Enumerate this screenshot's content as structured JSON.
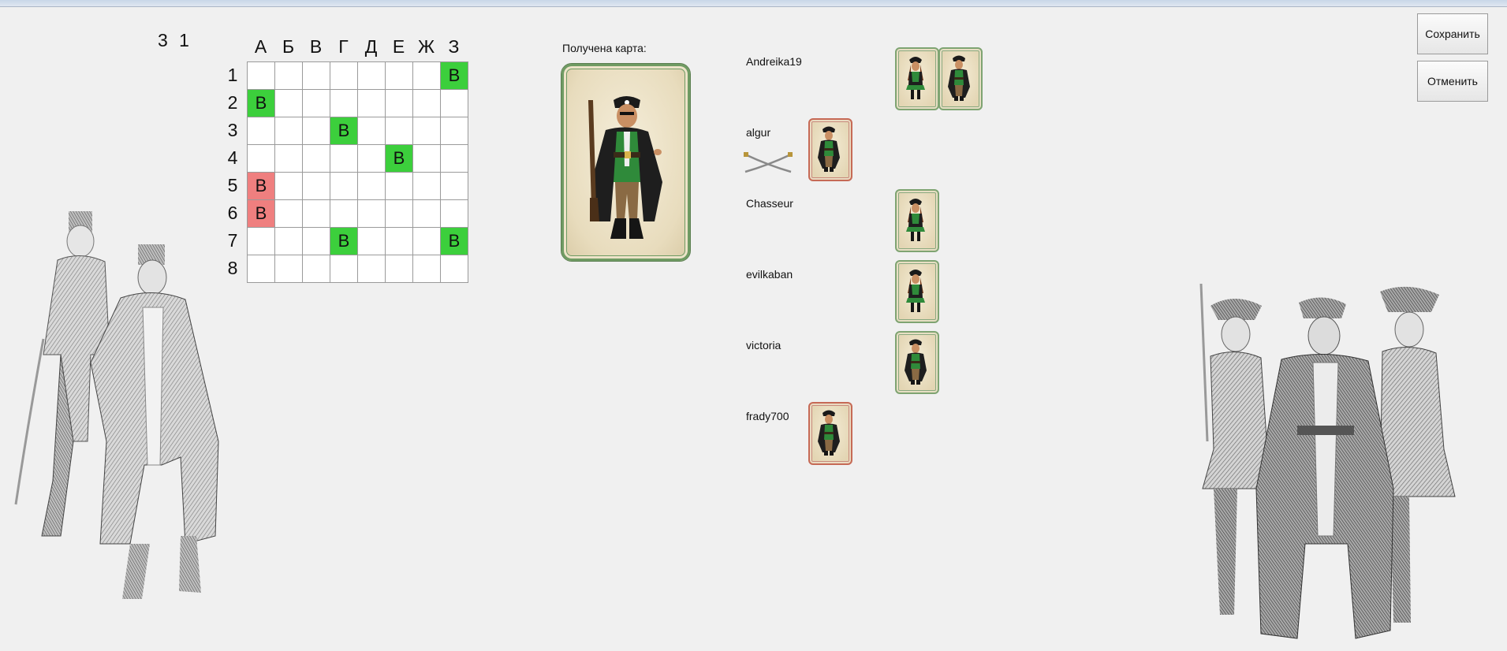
{
  "score": "3 1",
  "board": {
    "columns": [
      "А",
      "Б",
      "В",
      "Г",
      "Д",
      "Е",
      "Ж",
      "З"
    ],
    "rows": [
      "1",
      "2",
      "3",
      "4",
      "5",
      "6",
      "7",
      "8"
    ],
    "marked_cells": [
      {
        "row": "1",
        "col": "З",
        "text": "В",
        "color": "green"
      },
      {
        "row": "2",
        "col": "А",
        "text": "В",
        "color": "green"
      },
      {
        "row": "3",
        "col": "Г",
        "text": "В",
        "color": "green"
      },
      {
        "row": "4",
        "col": "Е",
        "text": "В",
        "color": "green"
      },
      {
        "row": "5",
        "col": "А",
        "text": "В",
        "color": "red"
      },
      {
        "row": "6",
        "col": "А",
        "text": "В",
        "color": "red"
      },
      {
        "row": "7",
        "col": "Г",
        "text": "В",
        "color": "green"
      },
      {
        "row": "7",
        "col": "З",
        "text": "В",
        "color": "green"
      }
    ]
  },
  "received_card": {
    "label": "Получена карта:",
    "character": "pirate-man"
  },
  "players": [
    {
      "name": "Andreika19",
      "cards": [
        {
          "character": "pirate-woman",
          "border": "green"
        },
        {
          "character": "pirate-man",
          "border": "green"
        }
      ]
    },
    {
      "name": "algur",
      "icon": "crossed-swords-icon",
      "cards": [
        {
          "character": "pirate-man",
          "border": "red"
        }
      ]
    },
    {
      "name": "Chasseur",
      "cards": [
        {
          "character": "pirate-woman",
          "border": "green"
        }
      ]
    },
    {
      "name": "evilkaban",
      "cards": [
        {
          "character": "pirate-woman",
          "border": "green"
        }
      ]
    },
    {
      "name": "victoria",
      "cards": [
        {
          "character": "pirate-man",
          "border": "green"
        }
      ]
    },
    {
      "name": "frady700",
      "cards": [
        {
          "character": "pirate-man",
          "border": "red"
        }
      ]
    }
  ],
  "buttons": {
    "save": "Сохранить",
    "cancel": "Отменить"
  },
  "colors": {
    "hit": "#3ccf3c",
    "miss": "#ef7f7f",
    "card_green_border": "#7fa472",
    "card_red_border": "#c66a56"
  }
}
